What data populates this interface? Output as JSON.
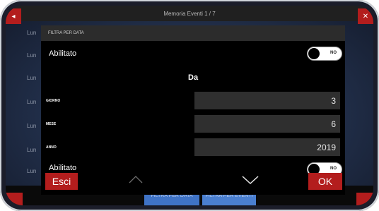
{
  "background": {
    "title": "Memoria Eventi 1 / 7",
    "rows": [
      "Lun",
      "Lun",
      "Lun",
      "Lun",
      "Lun",
      "Lun",
      "Lun"
    ],
    "tabs": {
      "data": "FILTRA PER DATA",
      "eventi": "FILTRA PER EVENTI"
    }
  },
  "dialog": {
    "header": "FILTRA PER DATA",
    "enabled_label": "Abilitato",
    "enabled_state": "NO",
    "section_title": "Da",
    "fields": [
      {
        "label": "GIORNO",
        "value": "3"
      },
      {
        "label": "MESE",
        "value": "6"
      },
      {
        "label": "ANNO",
        "value": "2019"
      }
    ],
    "enabled2_label": "Abilitato",
    "enabled2_state": "NO",
    "esci_label": "Esci",
    "ok_label": "OK"
  },
  "colors": {
    "accent_red": "#b31d1d",
    "tab_blue": "#3f73c6",
    "dialog_bg": "#000000",
    "field_bg": "#2f2f2f"
  },
  "icons": {
    "up": "chevron-up-icon",
    "down": "chevron-down-icon"
  }
}
